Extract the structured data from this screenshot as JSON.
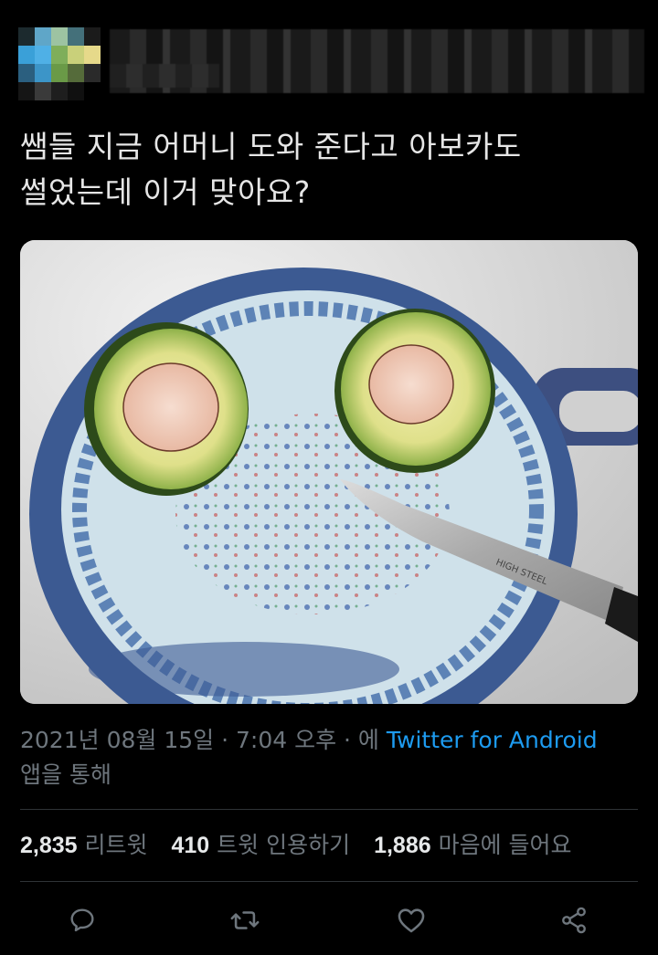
{
  "tweet": {
    "text_line1": "쌤들 지금 어머니 도와 준다고 아보카도",
    "text_line2": "썰었는데 이거 맞아요?"
  },
  "meta": {
    "date": "2021년 08월 15일",
    "sep1": " · ",
    "time": "7:04 오후",
    "sep2": " · 에 ",
    "source": "Twitter for Android",
    "suffix": "앱을 통해"
  },
  "stats": {
    "retweets_count": "2,835",
    "retweets_label": "리트윗",
    "quotes_count": "410",
    "quotes_label": "트윗 인용하기",
    "likes_count": "1,886",
    "likes_label": "마음에 들어요"
  },
  "actions": {
    "reply_icon": "reply-icon",
    "retweet_icon": "retweet-icon",
    "like_icon": "heart-icon",
    "share_icon": "share-icon"
  },
  "colors": {
    "background": "#000000",
    "text": "#e7e9ea",
    "secondary": "#6e767d",
    "link": "#1d9bf0",
    "icon": "#6e767d"
  }
}
